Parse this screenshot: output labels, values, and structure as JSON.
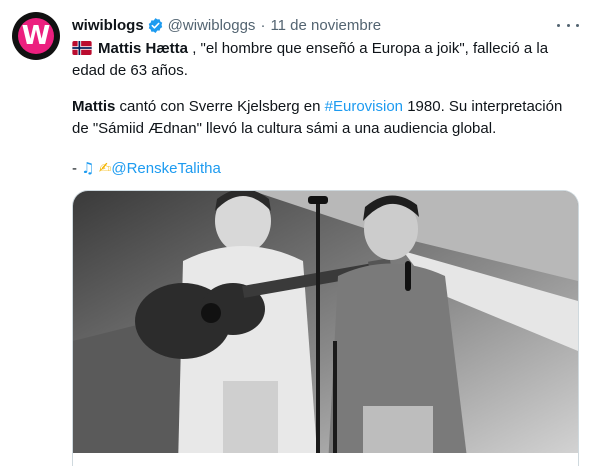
{
  "tweet": {
    "avatar_letter": "W",
    "display_name": "wiwiblogs",
    "handle": "@wiwibloggs",
    "separator": "·",
    "date": "11 de noviembre",
    "line1_name": "Mattis Hætta",
    "line1_rest": ", \"el hombre que enseñó a Europa a joik\", falleció a la edad de 63 años.",
    "line2_name": "Mattis",
    "line2_before_tag": " cantó con Sverre Kjelsberg en ",
    "hashtag": "#Eurovision",
    "line2_after_tag": " 1980. Su interpretación de \"Sámiid Ædnan\" llevó la cultura sámi a una audiencia global.",
    "credit_prefix": "- ",
    "music_emoji": "♫",
    "writing_emoji": "✍",
    "mention": "@RenskeTalitha"
  },
  "icons": {
    "verified": "verified-badge-icon",
    "flag": "norway-flag-icon",
    "more": "more-options-icon"
  },
  "colors": {
    "brand_pink": "#ec1f7f",
    "link_blue": "#1d9bf0",
    "muted_text": "#536471",
    "border": "#cfd9de"
  }
}
